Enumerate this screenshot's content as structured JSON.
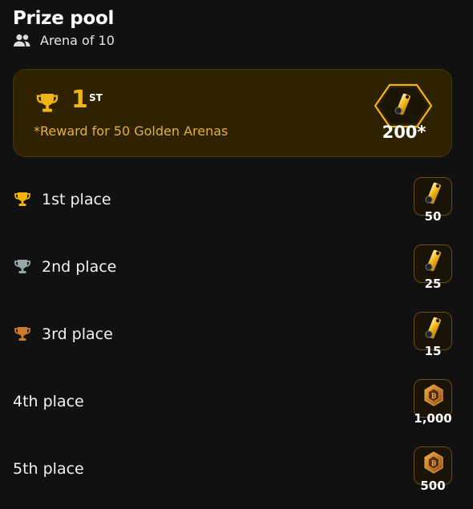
{
  "header": {
    "title": "Prize pool",
    "subtitle": "Arena of 10"
  },
  "banner": {
    "rank": "1",
    "rank_suffix": "ST",
    "note": "*Reward for 50 Golden Arenas",
    "amount": "200*",
    "reward_icon": "golden-ticket-icon"
  },
  "places": [
    {
      "label": "1st place",
      "medal": "gold-trophy-icon",
      "reward_icon": "golden-ticket-icon",
      "amount": "50"
    },
    {
      "label": "2nd place",
      "medal": "silver-trophy-icon",
      "reward_icon": "golden-ticket-icon",
      "amount": "25"
    },
    {
      "label": "3rd place",
      "medal": "bronze-trophy-icon",
      "reward_icon": "golden-ticket-icon",
      "amount": "15"
    },
    {
      "label": "4th place",
      "medal": "",
      "reward_icon": "coin-icon",
      "amount": "1,000"
    },
    {
      "label": "5th place",
      "medal": "",
      "reward_icon": "coin-icon",
      "amount": "500"
    }
  ],
  "colors": {
    "background": "#111111",
    "banner_bg": "#2e2201",
    "accent_gold": "#f0b515",
    "note": "#e2b13d",
    "gold_trophy": "#f5b400",
    "silver_trophy": "#9aa7a8",
    "bronze_trophy": "#cd7a2d"
  }
}
